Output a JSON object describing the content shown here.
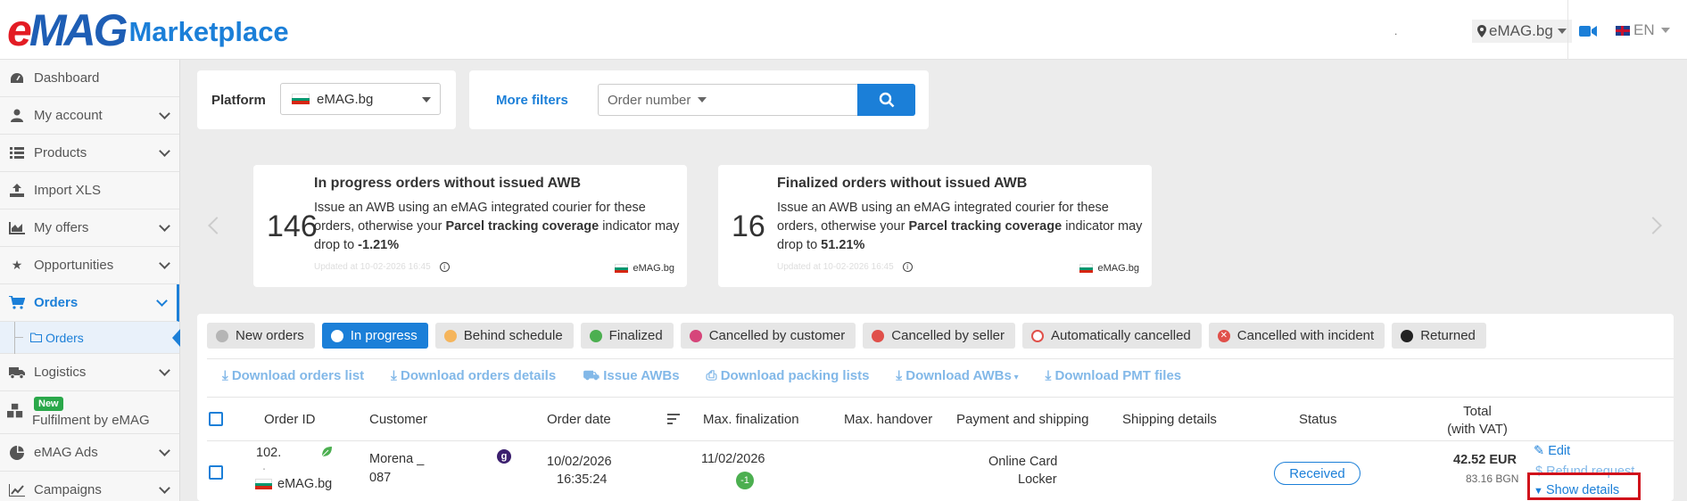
{
  "header": {
    "logo": "eMAG",
    "logo_e": "e",
    "logo_mag": "MAG",
    "logo_suffix": "Marketplace",
    "dot_text": ".",
    "site_selector": "eMAG.bg",
    "language": "EN"
  },
  "sidebar": {
    "items": [
      {
        "label": "Dashboard",
        "icon": "dashboard-icon"
      },
      {
        "label": "My account",
        "icon": "user-icon"
      },
      {
        "label": "Products",
        "icon": "list-icon"
      },
      {
        "label": "Import XLS",
        "icon": "upload-icon"
      },
      {
        "label": "My offers",
        "icon": "chart-icon"
      },
      {
        "label": "Opportunities",
        "icon": "star-icon"
      },
      {
        "label": "Orders",
        "icon": "cart-icon"
      },
      {
        "label": "Logistics",
        "icon": "truck-icon"
      },
      {
        "label": "Fulfilment by eMAG",
        "icon": "boxes-icon",
        "badge": "New"
      },
      {
        "label": "eMAG Ads",
        "icon": "pie-icon"
      },
      {
        "label": "Campaigns",
        "icon": "trend-icon"
      }
    ],
    "sub_item": "Orders"
  },
  "filters": {
    "platform_label": "Platform",
    "platform_value": "eMAG.bg",
    "more_filters": "More filters",
    "order_number_placeholder": "Order number"
  },
  "info_cards": [
    {
      "count": "146",
      "title": "In progress orders without issued AWB",
      "text_before": "Issue an AWB using an eMAG integrated courier for these orders, otherwise your ",
      "text_bold": "Parcel tracking coverage",
      "text_after": " indicator may drop to ",
      "value": "-1.21%",
      "updated": "Updated at 10-02-2026 16:45",
      "site": "eMAG.bg"
    },
    {
      "count": "16",
      "title": "Finalized orders without issued AWB",
      "text_before": "Issue an AWB using an eMAG integrated courier for these orders, otherwise your ",
      "text_bold": "Parcel tracking coverage",
      "text_after": " indicator may drop to ",
      "value": "51.21%",
      "updated": "Updated at 10-02-2026 16:45",
      "site": "eMAG.bg"
    }
  ],
  "status_tabs": [
    {
      "label": "New orders",
      "color": "#b5b5b5"
    },
    {
      "label": "In progress",
      "color": "#ffffff"
    },
    {
      "label": "Behind schedule",
      "color": "#f5b55c"
    },
    {
      "label": "Finalized",
      "color": "#4caf50"
    },
    {
      "label": "Cancelled by customer",
      "color": "#d6457a"
    },
    {
      "label": "Cancelled by seller",
      "color": "#e0504a"
    },
    {
      "label": "Automatically cancelled",
      "color": "#e0504a"
    },
    {
      "label": "Cancelled with incident",
      "color": "#e0504a"
    },
    {
      "label": "Returned",
      "color": "#222222"
    }
  ],
  "actions": [
    "Download orders list",
    "Download orders details",
    "Issue AWBs",
    "Download packing lists",
    "Download AWBs",
    "Download PMT files"
  ],
  "table": {
    "headers": {
      "order_id": "Order ID",
      "customer": "Customer",
      "order_date": "Order date",
      "max_finalization": "Max. finalization",
      "max_handover": "Max. handover",
      "payment_shipping": "Payment and shipping",
      "shipping_details": "Shipping details",
      "status": "Status",
      "total_line1": "Total",
      "total_line2": "(with VAT)"
    },
    "row": {
      "order_id": "102.",
      "order_id_sub": ".",
      "site": "eMAG.bg",
      "customer_line1": "Morena _",
      "customer_line2": "087",
      "customer_badge": "g",
      "order_date": "10/02/2026",
      "order_time": "16:35:24",
      "max_finalization": "11/02/2026",
      "days_left": "-1",
      "payment": "Online Card",
      "shipping": "Locker",
      "status": "Received",
      "total_eur": "42.52 EUR",
      "total_bgn": "83.16 BGN",
      "edit": "Edit",
      "refund": "Refund request",
      "show_details": "Show details"
    }
  },
  "colors": {
    "accent": "#1b7fd8",
    "highlight_box": "#d0111b",
    "received_border": "#1b7fd8"
  }
}
